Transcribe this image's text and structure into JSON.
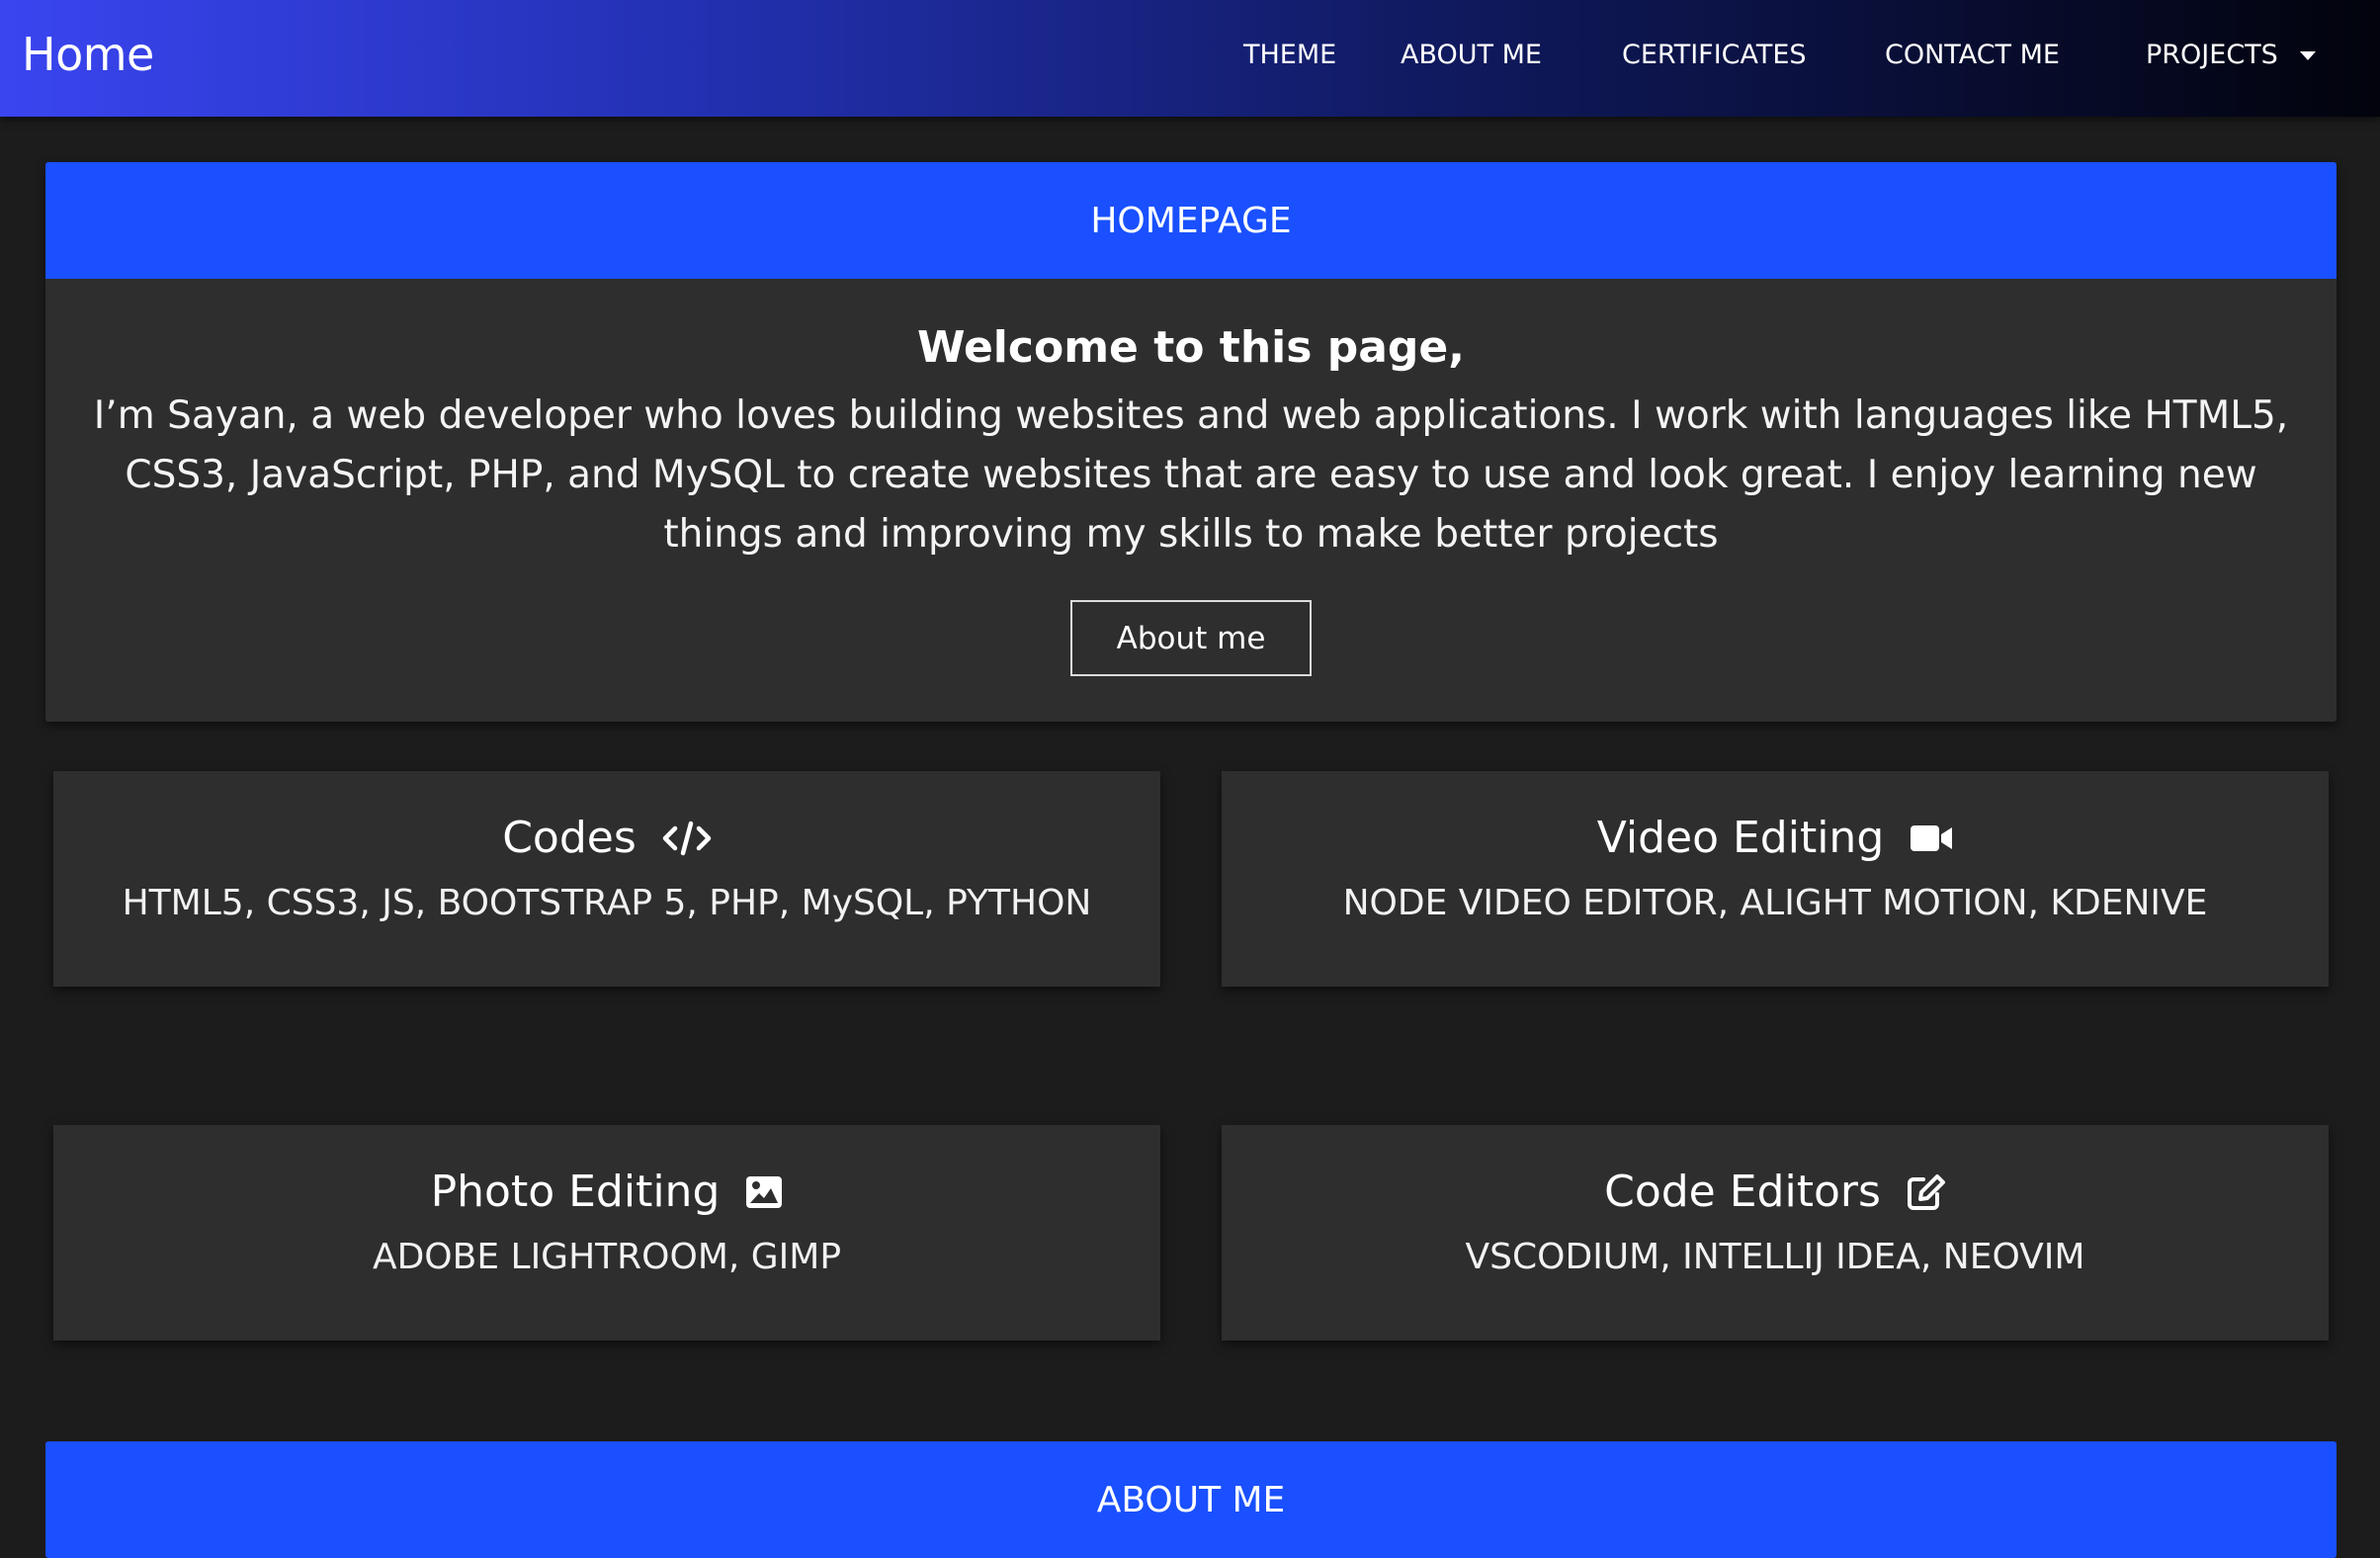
{
  "navbar": {
    "brand": "Home",
    "items": [
      {
        "label": "THEME"
      },
      {
        "label": "ABOUT ME"
      },
      {
        "label": "CERTIFICATES"
      },
      {
        "label": "CONTACT ME"
      },
      {
        "label": "PROJECTS"
      }
    ]
  },
  "hero": {
    "header": "HOMEPAGE",
    "title": "Welcome to this page,",
    "text": "I’m Sayan, a web developer who loves building websites and web applications. I work with languages like HTML5, CSS3, JavaScript, PHP, and MySQL to create websites that are easy to use and look great. I enjoy learning new things and improving my skills to make better projects",
    "button": "About me"
  },
  "cards": [
    {
      "title": "Codes",
      "icon": "code-icon",
      "text": "HTML5, CSS3, JS, BOOTSTRAP 5, PHP, MySQL, PYTHON"
    },
    {
      "title": "Video Editing",
      "icon": "video-camera-icon",
      "text": "NODE VIDEO EDITOR, ALIGHT MOTION, KDENIVE"
    },
    {
      "title": "Photo Editing",
      "icon": "image-icon",
      "text": "ADOBE LIGHTROOM, GIMP"
    },
    {
      "title": "Code Editors",
      "icon": "edit-icon",
      "text": "VSCODIUM, INTELLIJ IDEA, NEOVIM"
    }
  ],
  "about": {
    "header": "ABOUT ME"
  },
  "colors": {
    "accent": "#1a50ff",
    "background": "#1c1c1c",
    "card": "#2e2e2e",
    "nav_start": "#3a45f0",
    "nav_end": "#02030c"
  }
}
